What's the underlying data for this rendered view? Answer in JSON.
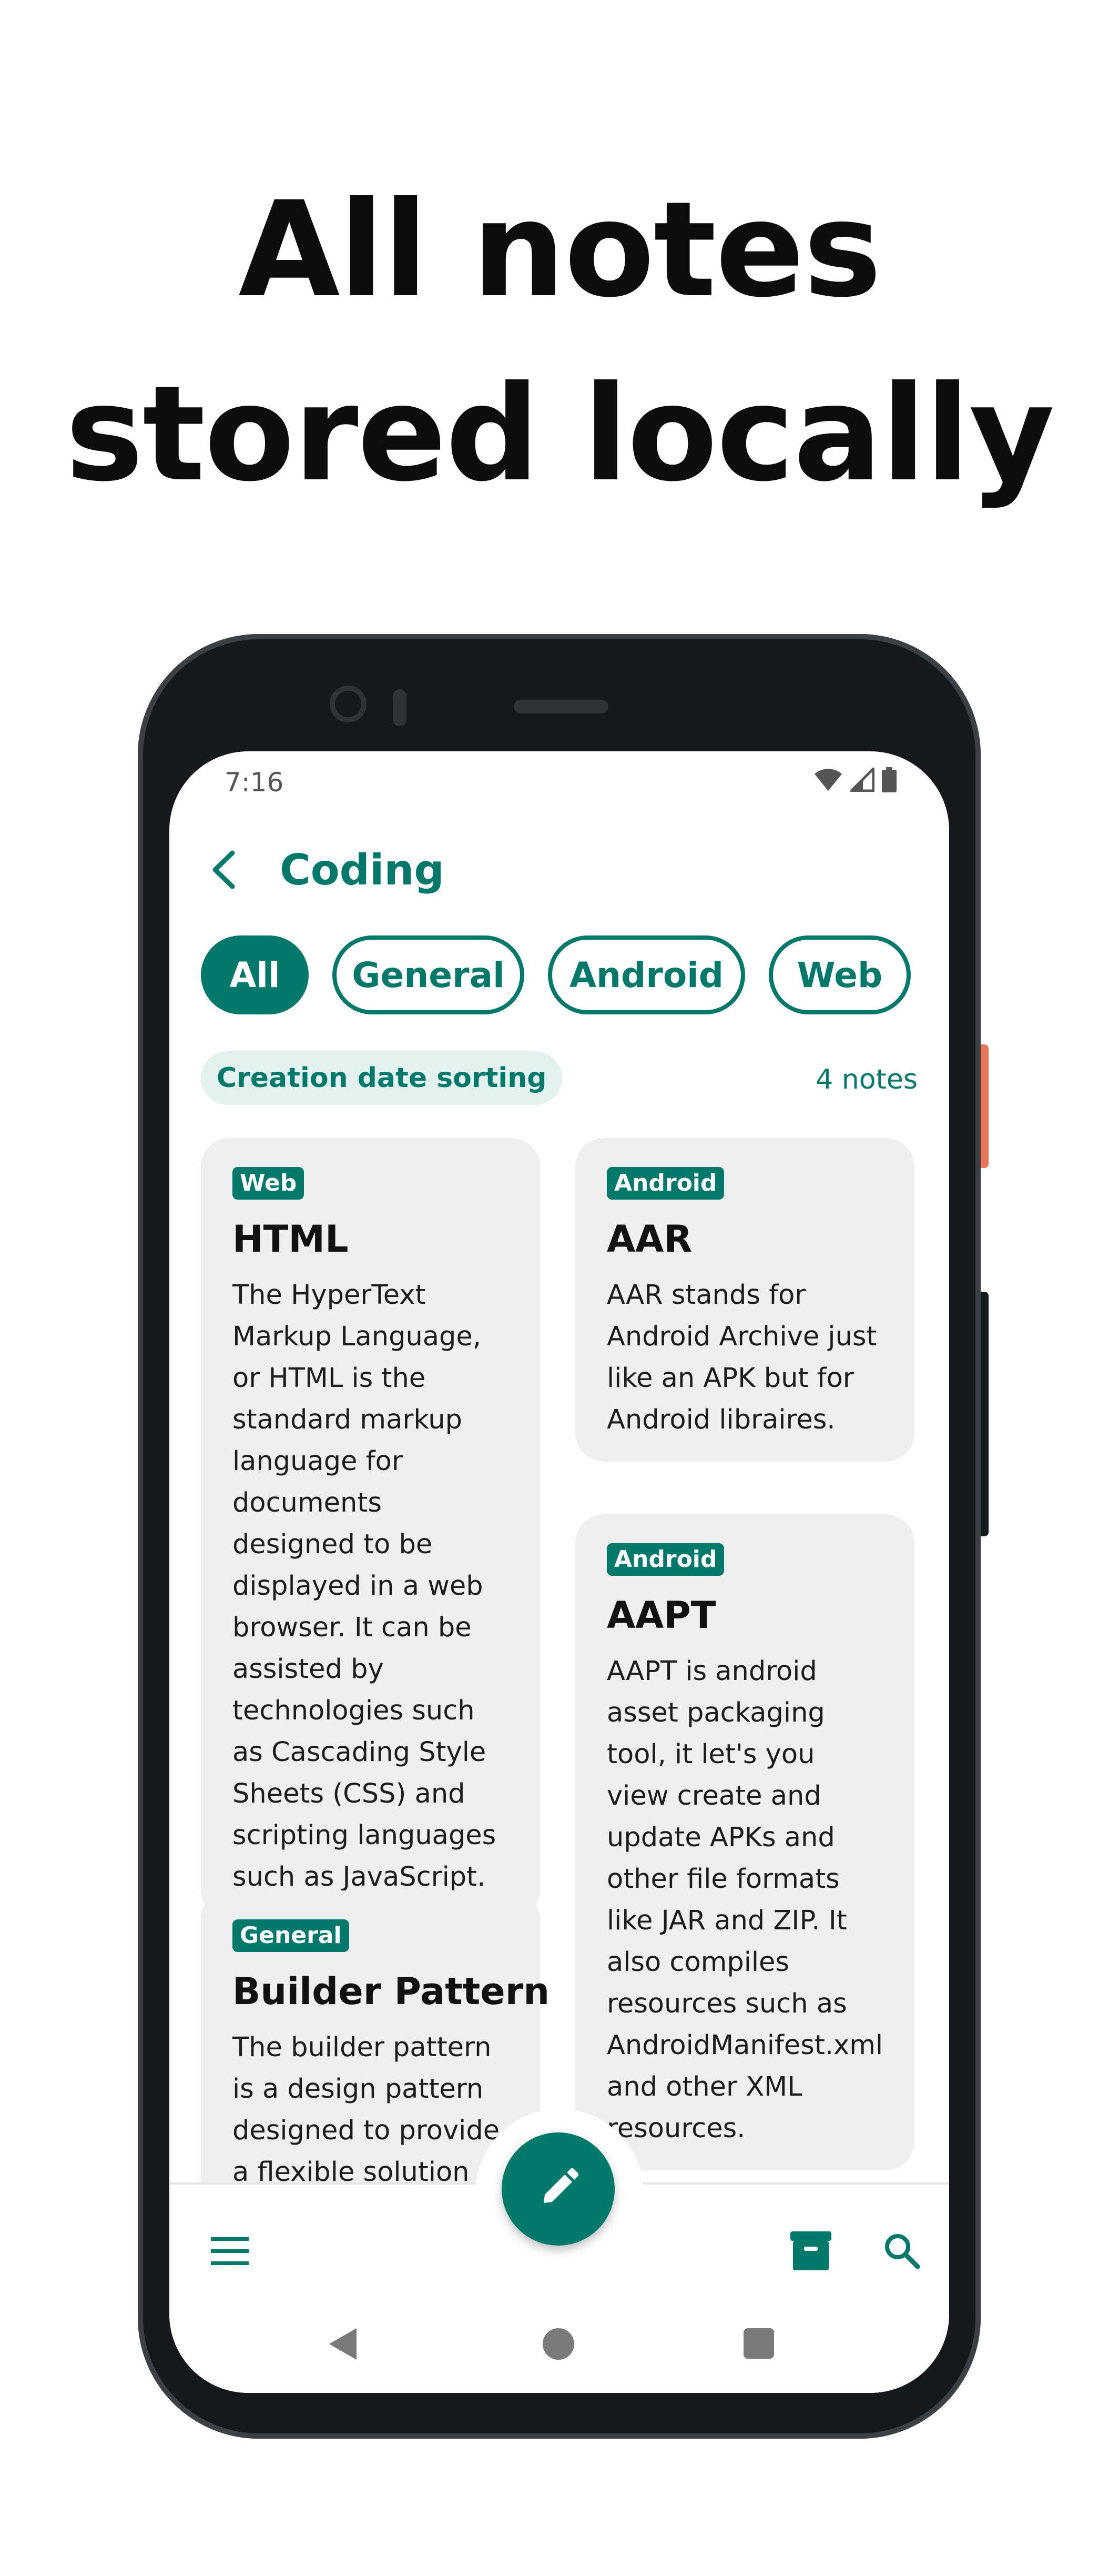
{
  "headline": {
    "line1": "All notes",
    "line2": "stored locally"
  },
  "status_bar": {
    "time": "7:16"
  },
  "app_bar": {
    "title": "Coding"
  },
  "filter_chips": [
    {
      "label": "All",
      "active": true
    },
    {
      "label": "General",
      "active": false
    },
    {
      "label": "Android",
      "active": false
    },
    {
      "label": "Web",
      "active": false
    }
  ],
  "sort": {
    "label": "Creation date sorting"
  },
  "note_count": "4 notes",
  "notes": [
    {
      "tag": "Web",
      "title": "HTML",
      "body": "The HyperText Markup Language, or HTML is the standard markup language for documents designed to be displayed in a web browser. It can be assisted by technologies such as Cascading Style Sheets (CSS) and scripting languages such as JavaScript."
    },
    {
      "tag": "Android",
      "title": "AAR",
      "body": "AAR stands for Android Archive just like an APK but for Android libraires."
    },
    {
      "tag": "Android",
      "title": "AAPT",
      "body": "AAPT is android asset packaging tool, it let's you view create and update APKs and other file formats like JAR and ZIP. It also compiles resources such as AndroidManifest.xml and other XML resources."
    },
    {
      "tag": "General",
      "title": "Builder Pattern",
      "body": "The builder pattern is a design pattern designed to provide a flexible solution"
    }
  ],
  "colors": {
    "accent": "#00796b",
    "card": "#efefef",
    "chip_bg_light": "#e3f1ef"
  },
  "icons": {
    "back": "arrow-back-icon",
    "wifi": "wifi-icon",
    "signal": "signal-icon",
    "battery": "battery-icon",
    "menu": "menu-icon",
    "archive": "archive-icon",
    "search": "search-icon",
    "fab": "edit-pencil-icon"
  }
}
